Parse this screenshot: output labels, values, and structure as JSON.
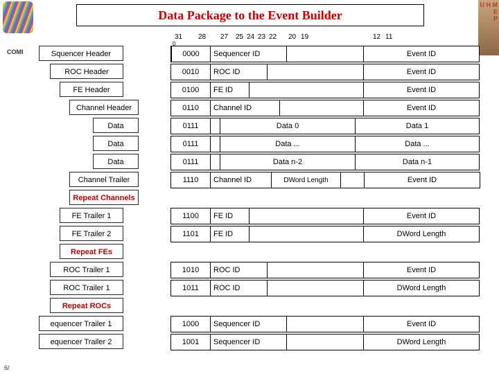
{
  "title": "Data Package to the Event Builder",
  "decor": {
    "uhm1": "U H M",
    "uhm2": "E",
    "uhm3": "P",
    "compass": "COMI",
    "footer": "6/"
  },
  "bits": {
    "b31": "31",
    "b28": "28",
    "b27": "27",
    "b25": "25",
    "b24": "24",
    "b23": "23",
    "b22": "22",
    "b20": "20",
    "b19": "19",
    "b12": "12",
    "b11": "11",
    "b0": "0"
  },
  "rows": {
    "seq_h": {
      "label": "Squencer Header",
      "code": "0000",
      "id": "Sequencer ID",
      "evt": "Event ID"
    },
    "roc_h": {
      "label": "ROC Header",
      "code": "0010",
      "id": "ROC ID",
      "evt": "Event ID"
    },
    "fe_h": {
      "label": "FE Header",
      "code": "0100",
      "id": "FE ID",
      "evt": "Event ID"
    },
    "ch_h": {
      "label": "Channel Header",
      "code": "0110",
      "id": "Channel ID",
      "evt": "Event ID"
    },
    "data0": {
      "label": "Data",
      "code": "0111",
      "left": "Data 0",
      "right": "Data 1"
    },
    "datad": {
      "label": "Data",
      "code": "0111",
      "left": "Data ...",
      "right": "Data ..."
    },
    "datan": {
      "label": "Data",
      "code": "0111",
      "left": "Data n-2",
      "right": "Data n-1"
    },
    "ch_t": {
      "label": "Channel Trailer",
      "code": "1110",
      "id": "Channel ID",
      "mid": "DWord Length",
      "evt": "Event ID"
    },
    "rep_ch": {
      "label": "Repeat Channels"
    },
    "fe_t1": {
      "label": "FE Trailer 1",
      "code": "1100",
      "id": "FE ID",
      "evt": "Event ID"
    },
    "fe_t2": {
      "label": "FE Trailer 2",
      "code": "1101",
      "id": "FE ID",
      "evt": "DWord Length"
    },
    "rep_fe": {
      "label": "Repeat FEs"
    },
    "roc_t1": {
      "label": "ROC Trailer 1",
      "code": "1010",
      "id": "ROC ID",
      "evt": "Event ID"
    },
    "roc_t2": {
      "label": "ROC Trailer 1",
      "code": "1011",
      "id": "ROC ID",
      "evt": "DWord Length"
    },
    "rep_roc": {
      "label": "Repeat ROCs"
    },
    "seq_t1": {
      "label": "equencer Trailer 1",
      "code": "1000",
      "id": "Sequencer ID",
      "evt": "Event ID"
    },
    "seq_t2": {
      "label": "equencer Trailer 2",
      "code": "1001",
      "id": "Sequencer ID",
      "evt": "DWord Length"
    }
  }
}
